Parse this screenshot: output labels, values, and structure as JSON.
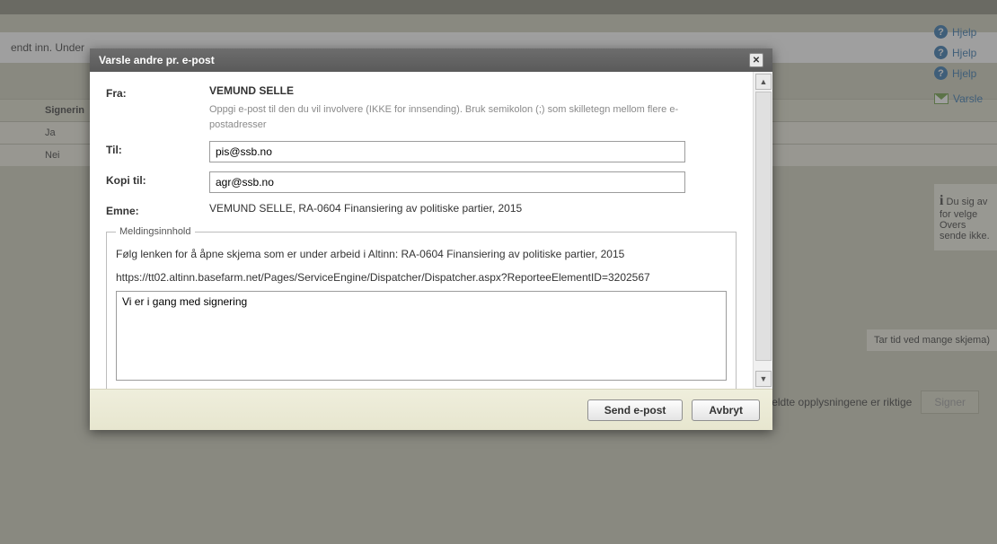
{
  "background": {
    "panel_text": "endt inn. Under",
    "table": {
      "head": "Signerin",
      "row1": "Ja",
      "row2": "Nei"
    },
    "help1": "Hjelp",
    "help2": "Hjelp",
    "help3": "Hjelp",
    "varsle": "Varsle",
    "info_text": "Du sig av for velge Overs sende ikke.",
    "footer_note": "Tar tid ved mange skjema)",
    "confirm_text": "eldte opplysningene er riktige",
    "sign_btn": "Signer"
  },
  "modal": {
    "title": "Varsle andre pr. e-post",
    "from_label": "Fra:",
    "from_value": "VEMUND SELLE",
    "from_hint": "Oppgi e-post til den du vil involvere (IKKE for innsending). Bruk semikolon (;) som skilletegn mellom flere e-postadresser",
    "to_label": "Til:",
    "to_value": "pis@ssb.no",
    "copy_label": "Kopi til:",
    "copy_value": "agr@ssb.no",
    "subject_label": "Emne:",
    "subject_value": "VEMUND SELLE, RA-0604 Finansiering av politiske partier, 2015",
    "fieldset_legend": "Meldingsinnhold",
    "body_line": "Følg lenken for å åpne skjema som er under arbeid i Altinn: RA-0604 Finansiering av politiske partier, 2015",
    "body_url": "https://tt02.altinn.basefarm.net/Pages/ServiceEngine/Dispatcher/Dispatcher.aspx?ReporteeElementID=3202567",
    "body_text": "Vi er i gang med signering ",
    "send_btn": "Send e-post",
    "cancel_btn": "Avbryt"
  }
}
